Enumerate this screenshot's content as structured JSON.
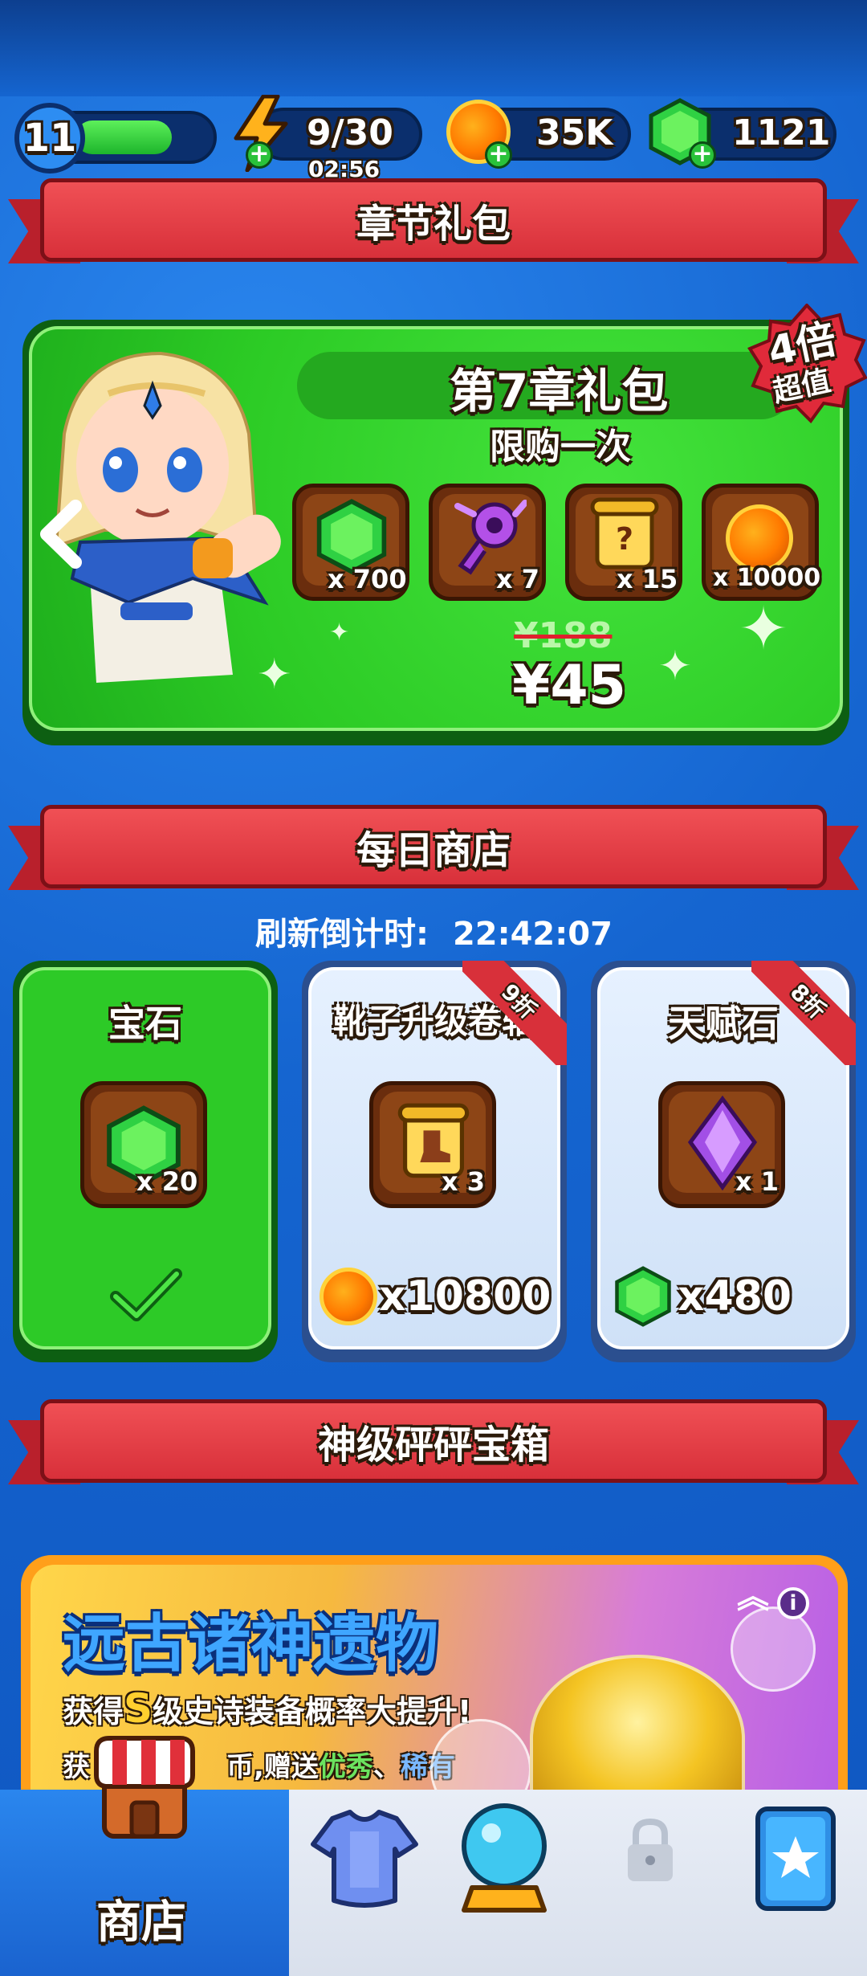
{
  "top_bar": {
    "level": "11",
    "energy": "9/30",
    "energy_timer": "02:56",
    "coins": "35K",
    "gems": "1121"
  },
  "chapter_section": {
    "banner_title": "章节礼包",
    "pack_title": "第7章礼包",
    "pack_subtitle": "限购一次",
    "badge_line1": "4倍",
    "badge_line2": "超值",
    "items": [
      {
        "icon": "gem-icon",
        "qty": "x 700"
      },
      {
        "icon": "key-icon",
        "qty": "x 7"
      },
      {
        "icon": "scroll-icon",
        "qty": "x 15"
      },
      {
        "icon": "coin-icon",
        "qty": "x 10000"
      }
    ],
    "old_price": "¥188",
    "price": "¥45"
  },
  "daily_shop": {
    "banner_title": "每日商店",
    "refresh_label": "刷新倒计时:",
    "refresh_time": "22:42:07",
    "cards": [
      {
        "title": "宝石",
        "qty": "x 20",
        "icon": "gem-icon",
        "state": "claimed"
      },
      {
        "title": "靴子升级卷轴",
        "qty": "x 3",
        "icon": "boot-scroll-icon",
        "discount": "9折",
        "price": "x10800",
        "currency": "coin-icon"
      },
      {
        "title": "天赋石",
        "qty": "x 1",
        "icon": "purple-crystal-icon",
        "discount": "8折",
        "price": "x480",
        "currency": "gem-icon"
      }
    ]
  },
  "gods_chest": {
    "banner_title": "神级砰砰宝箱",
    "headline": "远古诸神遗物",
    "line1_pre": "获得",
    "line1_s": "S",
    "line1_post": "级史诗装备概率大提升!",
    "line2_a": "获",
    "line2_b": "币,赠送",
    "line2_c": "优秀",
    "line2_d": "、",
    "line2_e": "稀有"
  },
  "bottom_nav": {
    "shop_label": "商店"
  },
  "colors": {
    "banner_red": "#d8303a",
    "pack_green": "#2ccb25",
    "nav_active_blue": "#1a63cf"
  }
}
